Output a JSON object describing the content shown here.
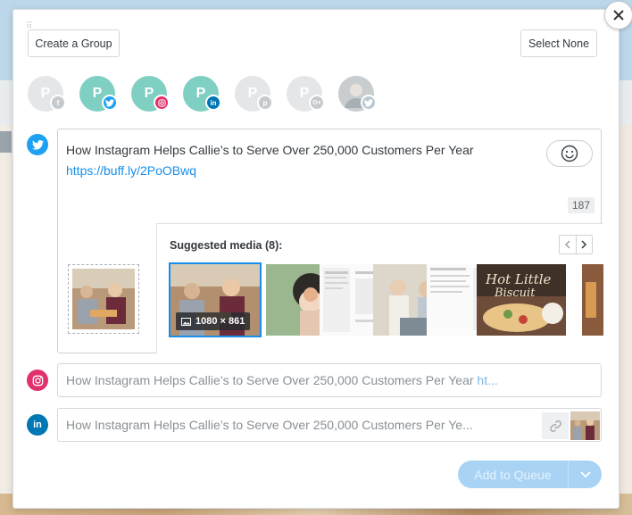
{
  "header": {
    "create_group_label": "Create a Group",
    "select_none_label": "Select None"
  },
  "profiles": [
    {
      "network": "facebook",
      "selected": false,
      "color": "#e4e6e8",
      "badge_color": "#c5cace"
    },
    {
      "network": "twitter",
      "selected": true,
      "color": "#7fcfc2",
      "badge_color": "#1da1f2"
    },
    {
      "network": "instagram",
      "selected": true,
      "color": "#7fcfc2",
      "badge_color": "#e1306c"
    },
    {
      "network": "linkedin",
      "selected": true,
      "color": "#7fcfc2",
      "badge_color": "#0077b5"
    },
    {
      "network": "pinterest",
      "selected": false,
      "color": "#e4e6e8",
      "badge_color": "#c5cace"
    },
    {
      "network": "google-plus",
      "selected": false,
      "color": "#e4e6e8",
      "badge_color": "#c5cace"
    },
    {
      "network": "twitter-personal",
      "selected": false,
      "color": "#d9dcde",
      "badge_color": "#b9c9d4"
    }
  ],
  "composer": {
    "text": "How Instagram Helps Callie’s to Serve Over 250,000 Customers Per Year",
    "link": "https://buff.ly/2PoOBwq",
    "char_count": "187",
    "suggested_title": "Suggested media (8):",
    "selected_dimensions": "1080 × 861"
  },
  "instagram_field": {
    "text": "How Instagram Helps Callie’s to Serve Over 250,000 Customers Per Year",
    "link_fragment": "ht..."
  },
  "linkedin_field": {
    "text": "How Instagram Helps Callie’s to Serve Over 250,000 Customers Per Ye..."
  },
  "footer": {
    "queue_label": "Add to Queue"
  },
  "colors": {
    "twitter": "#1da1f2",
    "instagram": "#e1306c",
    "linkedin": "#0077b5",
    "accent": "#168eea"
  }
}
